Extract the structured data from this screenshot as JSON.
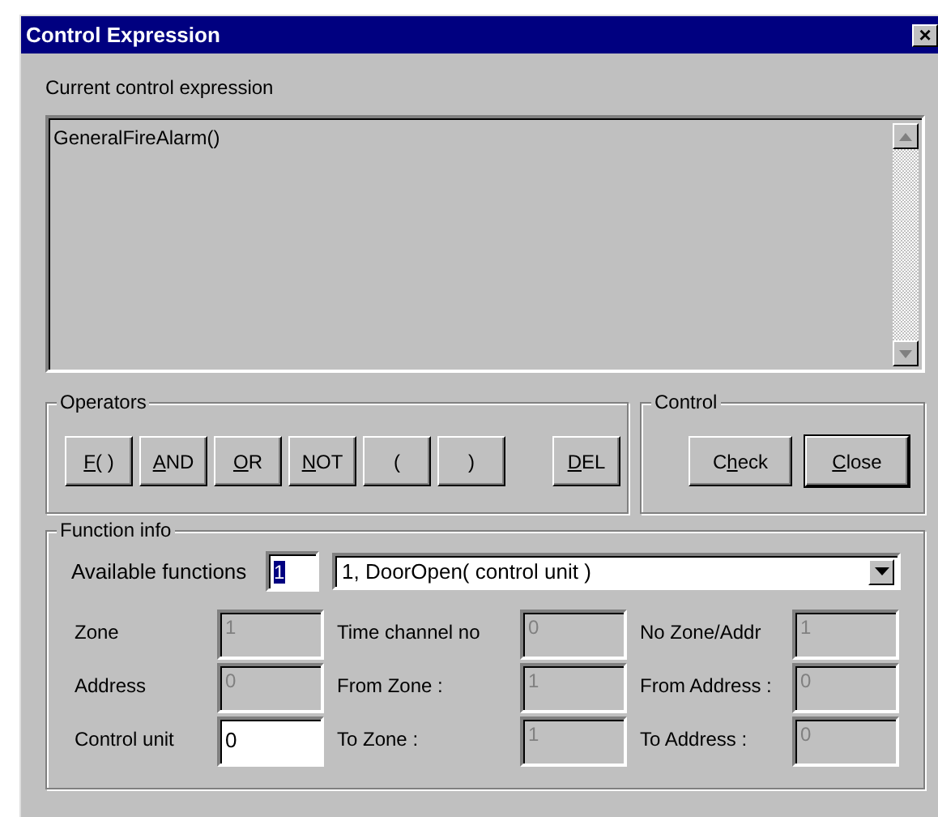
{
  "window": {
    "title": "Control Expression",
    "close": "×"
  },
  "expression": {
    "label": "Current control expression",
    "value": "GeneralFireAlarm()"
  },
  "operators": {
    "title": "Operators",
    "buttons": [
      {
        "mnemonic": "F",
        "after": "( )"
      },
      {
        "mnemonic": "A",
        "after": "ND"
      },
      {
        "mnemonic": "O",
        "after": "R"
      },
      {
        "mnemonic": "N",
        "after": "OT"
      },
      {
        "after": "("
      },
      {
        "after": ")"
      },
      {
        "mnemonic": "D",
        "after": "EL"
      }
    ]
  },
  "control": {
    "title": "Control",
    "buttons": [
      {
        "before": "C",
        "mnemonic": "h",
        "after": "eck",
        "default": false
      },
      {
        "mnemonic": "C",
        "after": "lose",
        "default": true
      }
    ]
  },
  "function_info": {
    "title": "Function info",
    "available_label": "Available functions",
    "available_value": "1",
    "dropdown": "1, DoorOpen( control unit )",
    "fields": [
      {
        "label": "Zone",
        "value": "1",
        "disabled": true
      },
      {
        "label": "Time channel no",
        "value": "0",
        "disabled": true
      },
      {
        "label": "No Zone/Addr",
        "value": "1",
        "disabled": true
      },
      {
        "label": "Address",
        "value": "0",
        "disabled": true
      },
      {
        "label": "From Zone :",
        "value": "1",
        "disabled": true
      },
      {
        "label": "From Address :",
        "value": "0",
        "disabled": true
      },
      {
        "label": "Control unit",
        "value": "0",
        "disabled": false
      },
      {
        "label": "To Zone :",
        "value": "1",
        "disabled": true
      },
      {
        "label": "To Address :",
        "value": "0",
        "disabled": true
      }
    ]
  }
}
